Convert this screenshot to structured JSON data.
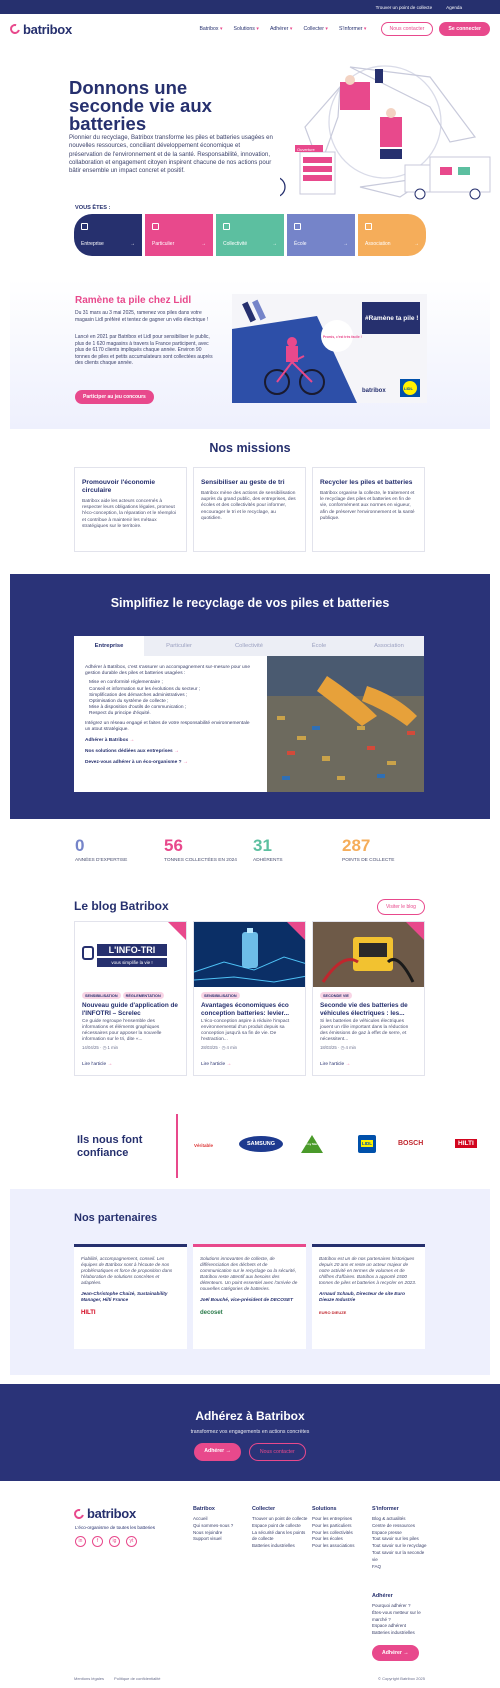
{
  "topbar": {
    "find": "Trouver un point de collecte",
    "agenda": "Agenda"
  },
  "header": {
    "logo": "batribox",
    "nav": [
      "Batribox",
      "Solutions",
      "Adhérer",
      "Collecter",
      "S'informer"
    ],
    "btn_login": "Nous contacter",
    "btn_signup": "Se connecter"
  },
  "hero": {
    "title": "Donnons une seconde vie aux batteries",
    "text": "Pionnier du recyclage, Batribox transforme les piles et batteries usagées en nouvelles ressources, conciliant développement économique et préservation de l'environnement et de la santé. Responsabilité, innovation, collaboration et engagement citoyen inspirent chacune de nos actions pour bâtir ensemble un impact concret et positif.",
    "vous": "VOUS ÊTES :",
    "cards": [
      {
        "label": "Entreprise",
        "color": "#26306e",
        "icon": "building-icon"
      },
      {
        "label": "Particulier",
        "color": "#e8498c",
        "icon": "person-icon"
      },
      {
        "label": "Collectivité",
        "color": "#5cbfa0",
        "icon": "town-icon"
      },
      {
        "label": "École",
        "color": "#7584c9",
        "icon": "school-icon"
      },
      {
        "label": "Association",
        "color": "#f5ad5a",
        "icon": "handshake-icon"
      }
    ],
    "illustration_sign": "Ouverture"
  },
  "lidl": {
    "title": "Ramène ta pile chez Lidl",
    "p1": "Du 31 mars au 3 mai 2025, ramenez vos piles dans votre magasin Lidl préféré et tentez de gagner un vélo électrique !",
    "p2": "Lancé en 2021 par Batribox et Lidl pour sensibiliser le public, plus de 1 620 magasins à travers la France participent, avec plus de 6170 clients impliqués chaque année. Environ 90 tonnes de piles et petits accumulateurs sont collectées auprès des clients chaque année.",
    "button": "Participer au jeu concours",
    "img_hashtag": "#Ramène ta pile !",
    "img_bubble": "Promis, c'est très facile !",
    "img_logo": "batribox",
    "img_lidl": "LIDL"
  },
  "missions": {
    "title": "Nos missions",
    "items": [
      {
        "title": "Promouvoir l'économie circulaire",
        "text": "Batribox aide les acteurs concernés à respecter leurs obligations légales, promeut l'éco-conception, la réparation et le réemploi et contribue à maintenir les métaux stratégiques sur le territoire."
      },
      {
        "title": "Sensibiliser au geste de tri",
        "text": "Batribox mène des actions de sensibilisation auprès du grand public, des entreprises, des écoles et des collectivités pour informer, encourager le tri et le recyclage, au quotidien."
      },
      {
        "title": "Recycler les piles et batteries",
        "text": "Batribox organise la collecte, le traitement et le recyclage des piles et batteries en fin de vie, conformément aux normes en vigueur, afin de préserver l'environnement et la santé publique."
      }
    ]
  },
  "simplify": {
    "title": "Simplifiez le recyclage de vos piles et batteries",
    "tabs": [
      "Entreprise",
      "Particulier",
      "Collectivité",
      "École",
      "Association"
    ],
    "intro": "Adhérer à Batribox, c'est s'assurer un accompagnement sur-mesure pour une gestion durable des piles et batteries usagées :",
    "bullets": [
      "Mise en conformité réglementaire ;",
      "Conseil et information sur les évolutions du secteur ;",
      "Simplification des démarches administratives ;",
      "Optimisation du système de collecte ;",
      "Mise à disposition d'outils de communication ;",
      "Respect du principe d'équité."
    ],
    "outro": "Intégrez un réseau engagé et faites de votre responsabilité environnementale un atout stratégique.",
    "links": [
      "Adhérer à Batribox",
      "Nos solutions dédiées aux entreprises",
      "Devez-vous adhérer à un éco-organisme ?"
    ]
  },
  "stats": [
    {
      "value": "0",
      "label": "ANNÉES D'EXPERTISE",
      "color": "#7584c9"
    },
    {
      "value": "56",
      "label": "TONNES COLLECTÉES EN 2024",
      "color": "#e8498c"
    },
    {
      "value": "31",
      "label": "ADHÉRENTS",
      "color": "#5cbfa0"
    },
    {
      "value": "287",
      "label": "POINTS DE COLLECTE",
      "color": "#f5ad5a"
    }
  ],
  "blog": {
    "title": "Le blog Batribox",
    "visit": "Visiter le blog",
    "posts": [
      {
        "tags": [
          "SENSIBILISATION",
          "RÉGLEMENTATION"
        ],
        "img_text": "L'INFO-TRI",
        "img_sub": "vous simplifie la vie !",
        "title": "Nouveau guide d'application de l'INFOTRI – Screlec",
        "excerpt": "Ce guide regroupe l'ensemble des informations et éléments graphiques nécessaires pour apposer la nouvelle information sur le tri, dite «...",
        "date": "14/04/25",
        "time": "1 min",
        "read": "Lire l'article"
      },
      {
        "tags": [
          "SENSIBILISATION"
        ],
        "img_text": "",
        "img_sub": "",
        "title": "Avantages économiques éco conception batteries: levier...",
        "excerpt": "L'éco-conception aspire à réduire l'impact environnemental d'un produit depuis sa conception jusqu'à sa fin de vie. De l'extraction...",
        "date": "28/03/25",
        "time": "4 min",
        "read": "Lire l'article"
      },
      {
        "tags": [
          "SECONDE VIE"
        ],
        "img_text": "",
        "img_sub": "",
        "title": "Seconde vie des batteries de véhicules électriques : les...",
        "excerpt": "Si les batteries de véhicules électriques jouent un rôle important dans la réduction des émissions de gaz à effet de serre, et nécessitent...",
        "date": "18/03/25",
        "time": "4 min",
        "read": "Lire l'article"
      }
    ]
  },
  "trust": {
    "title": "Ils nous font confiance",
    "brands": [
      {
        "name": "Véritable",
        "color": "#d33"
      },
      {
        "name": "SAMSUNG",
        "color": "#1d3a8f"
      },
      {
        "name": "Leroy Merlin",
        "color": "#4a9a2a"
      },
      {
        "name": "LIDL",
        "color": "#0050aa"
      },
      {
        "name": "BOSCH",
        "color": "#c0262d"
      },
      {
        "name": "HILTI",
        "color": "#d2051e"
      }
    ]
  },
  "partners": {
    "title": "Nos partenaires",
    "items": [
      {
        "quote": "Fiabilité, accompagnement, conseil. Les équipes de Batribox sont à l'écoute de nos problématiques et force de proposition dans l'élaboration de solutions concrètes et adaptées.",
        "author": "Jean-Christophe Chaizé, Sustainability Manager, Hilti France",
        "logo": "HILTI",
        "logo_color": "#d2051e"
      },
      {
        "quote": "Solutions innovantes de collecte, de différenciation des déchets et de communication sur le recyclage ou la sécurité, Batribox reste attentif aux besoins des détenteurs. Un point essentiel avec l'arrivée de nouvelles catégories de batteries.",
        "author": "Joël Bouché, vice-président de DECOSET",
        "logo": "decoset",
        "logo_color": "#2a7a4a"
      },
      {
        "quote": "Batribox est un de nos partenaires historiques depuis 20 ans et reste un acteur majeur de notre activité en termes de volumes et de chiffres d'affaires. Batribox a apporté 1500 tonnes de piles et batteries à recycler en 2023.",
        "author": "Arnaud Schaub, Directeur de site Euro Dieuze Industrie",
        "logo": "EURO DIEUZE",
        "logo_color": "#c0262d"
      }
    ]
  },
  "join": {
    "title": "Adhérez à Batribox",
    "subtitle": "transformez vos engagements en actions concrètes",
    "btn_primary": "Adhérer",
    "btn_secondary": "Nous contacter"
  },
  "footer": {
    "logo": "batribox",
    "tagline": "L'éco-organisme de toutes les batteries",
    "socials": [
      "in",
      "f",
      "ig",
      "yt"
    ],
    "cols": [
      {
        "title": "Batribox",
        "links": [
          "Accueil",
          "Qui sommes-nous ?",
          "Nous rejoindre",
          "Support visuel"
        ]
      },
      {
        "title": "Collecter",
        "links": [
          "Trouver un point de collecte",
          "Espace point de collecte",
          "La sécurité dans les points de collecte",
          "Batteries industrielles"
        ]
      },
      {
        "title": "Solutions",
        "links": [
          "Pour les entreprises",
          "Pour les particuliers",
          "Pour les collectivités",
          "Pour les écoles",
          "Pour les associations"
        ]
      },
      {
        "title": "S'informer",
        "links": [
          "Blog & actualités",
          "Centre de ressources",
          "Espace presse",
          "Tout savoir sur les piles",
          "Tout savoir sur le recyclage",
          "Tout savoir sur la seconde vie",
          "FAQ"
        ]
      }
    ],
    "col_extra": {
      "title": "Adhérer",
      "links": [
        "Pourquoi adhérer ?",
        "Êtes-vous metteur sur le marché ?",
        "Espace adhérent",
        "Batteries industrielles"
      ]
    },
    "button": "Adhérer",
    "legal": [
      "Mentions légales",
      "Politique de confidentialité"
    ],
    "copyright": "© Copyright Batribox 2025"
  }
}
